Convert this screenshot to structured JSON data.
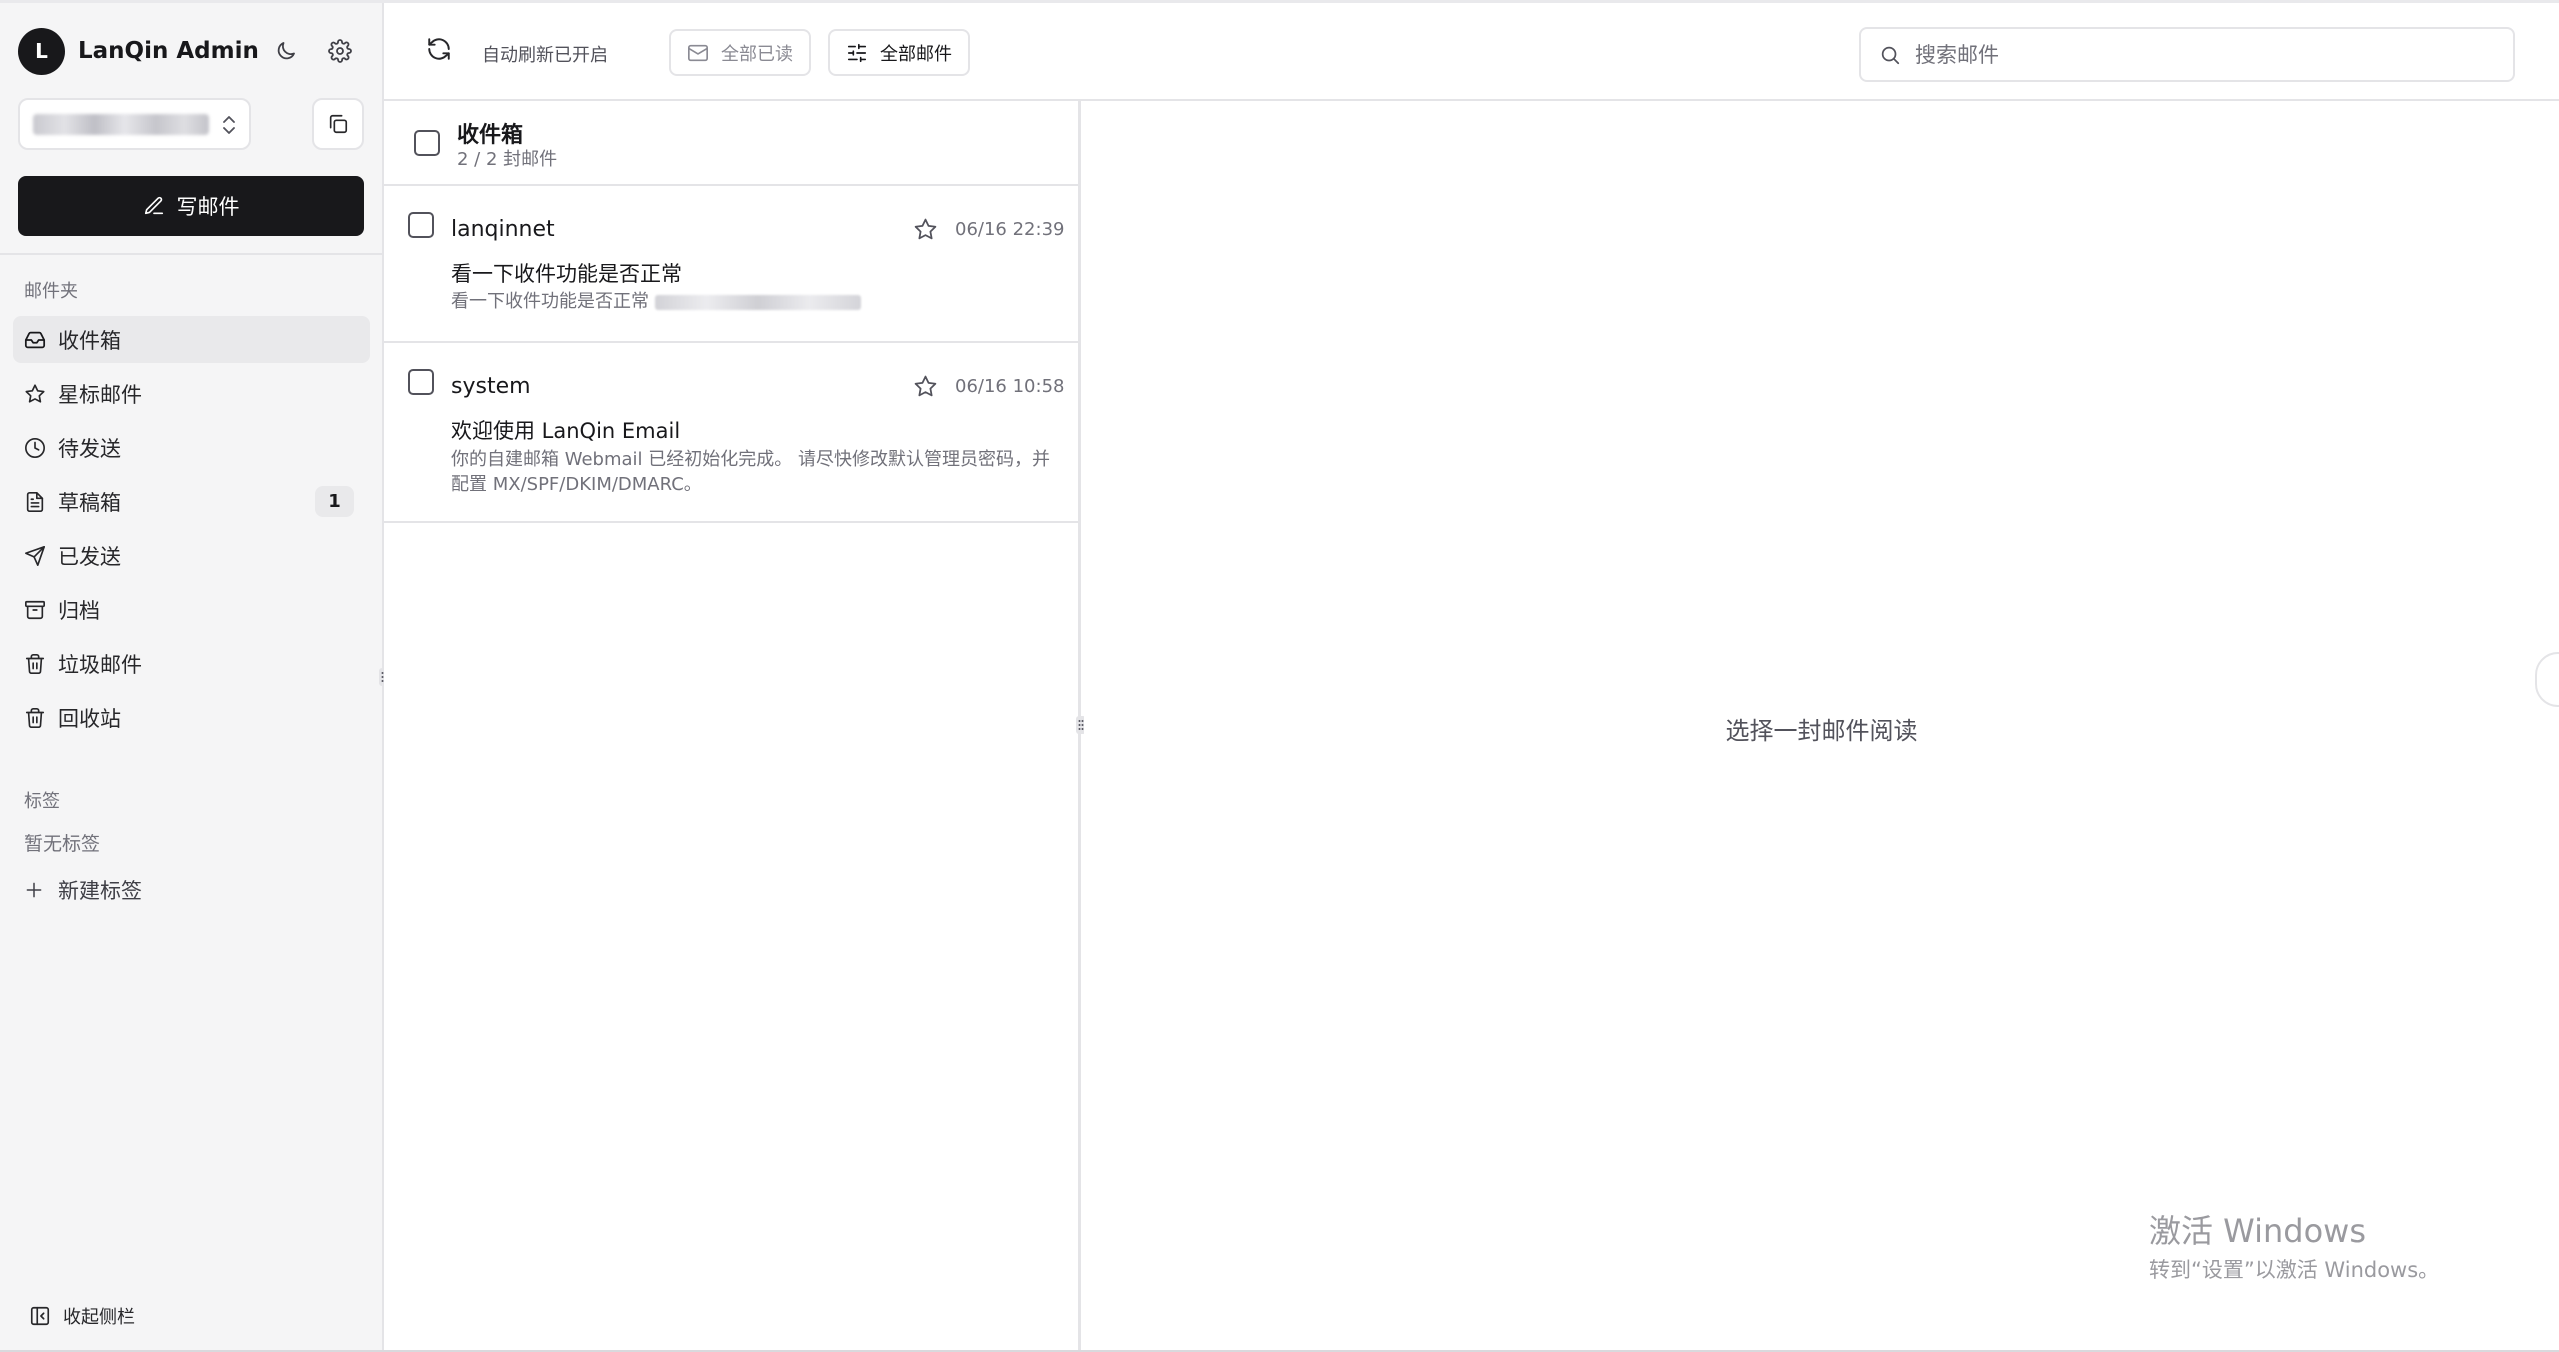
{
  "app": {
    "avatar_initial": "L",
    "name": "LanQin Admin"
  },
  "sidebar": {
    "compose_label": "写邮件",
    "folders_title": "邮件夹",
    "items": [
      {
        "label": "收件箱",
        "icon": "inbox-icon",
        "active": true
      },
      {
        "label": "星标邮件",
        "icon": "star-icon"
      },
      {
        "label": "待发送",
        "icon": "clock-icon"
      },
      {
        "label": "草稿箱",
        "icon": "draft-icon",
        "badge": "1"
      },
      {
        "label": "已发送",
        "icon": "send-icon"
      },
      {
        "label": "归档",
        "icon": "archive-icon"
      },
      {
        "label": "垃圾邮件",
        "icon": "trash-icon"
      },
      {
        "label": "回收站",
        "icon": "trash-icon"
      }
    ],
    "labels_title": "标签",
    "no_labels": "暂无标签",
    "new_label": "新建标签",
    "collapse_label": "收起侧栏"
  },
  "toolbar": {
    "auto_refresh": "自动刷新已开启",
    "mark_all_read": "全部已读",
    "filter_all": "全部邮件",
    "search_placeholder": "搜索邮件"
  },
  "list": {
    "folder_title": "收件箱",
    "count": "2 / 2 封邮件",
    "mails": [
      {
        "sender": "lanqinnet",
        "time": "06/16 22:39",
        "subject": "看一下收件功能是否正常",
        "preview": "看一下收件功能是否正常"
      },
      {
        "sender": "system",
        "time": "06/16 10:58",
        "subject": "欢迎使用 LanQin Email",
        "preview": "你的自建邮箱 Webmail 已经初始化完成。 请尽快修改默认管理员密码，并配置 MX/SPF/DKIM/DMARC。"
      }
    ]
  },
  "reading": {
    "empty_message": "选择一封邮件阅读"
  },
  "watermark": {
    "title": "激活 Windows",
    "subtitle": "转到“设置”以激活 Windows。"
  }
}
